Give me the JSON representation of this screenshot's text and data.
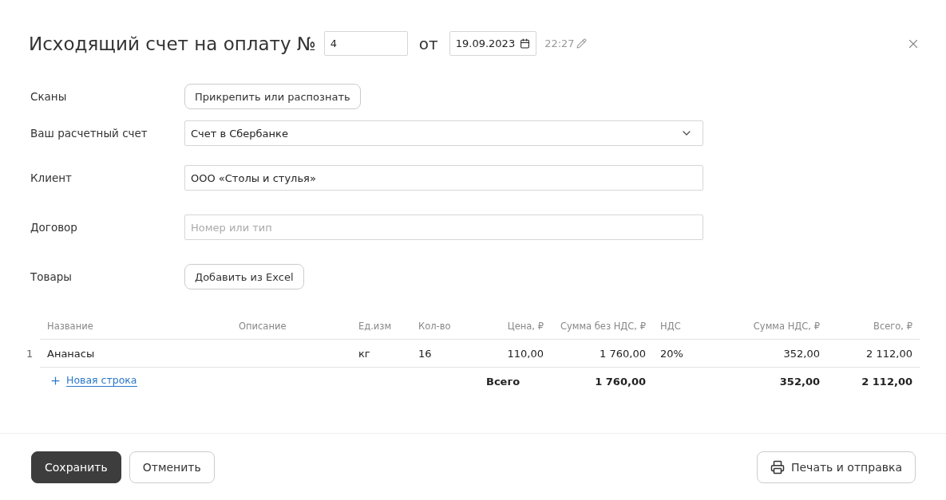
{
  "header": {
    "title": "Исходящий счет на оплату №",
    "number": "4",
    "from_label": "от",
    "date": "19.09.2023",
    "time": "22:27"
  },
  "form": [
    {
      "label": "Сканы",
      "kind": "button",
      "text": "Прикрепить или распознать"
    },
    {
      "label": "Ваш расчетный счет",
      "kind": "select",
      "value": "Счет в Сбербанке"
    },
    {
      "label": "Клиент",
      "kind": "input",
      "value": "ООО «Столы и стулья»"
    },
    {
      "label": "Договор",
      "kind": "input",
      "placeholder": "Номер или тип"
    },
    {
      "label": "Товары",
      "kind": "button",
      "text": "Добавить из Excel"
    }
  ],
  "table": {
    "columns": [
      "Название",
      "Описание",
      "Ед.изм",
      "Кол-во",
      "Цена, ₽",
      "Сумма без НДС, ₽",
      "НДС",
      "Сумма НДС, ₽",
      "Всего, ₽"
    ],
    "rows": [
      {
        "number": "1",
        "cells": [
          "Ананасы",
          "",
          "кг",
          "16",
          "110,00",
          "1 760,00",
          "20%",
          "352,00",
          "2 112,00"
        ]
      }
    ],
    "add_row": "Новая строка",
    "totals": {
      "label": "Всего",
      "sum_without_vat": "1 760,00",
      "vat_sum": "352,00",
      "total": "2 112,00"
    }
  },
  "footer": {
    "save": "Сохранить",
    "cancel": "Отменить",
    "print": "Печать и отправка"
  }
}
